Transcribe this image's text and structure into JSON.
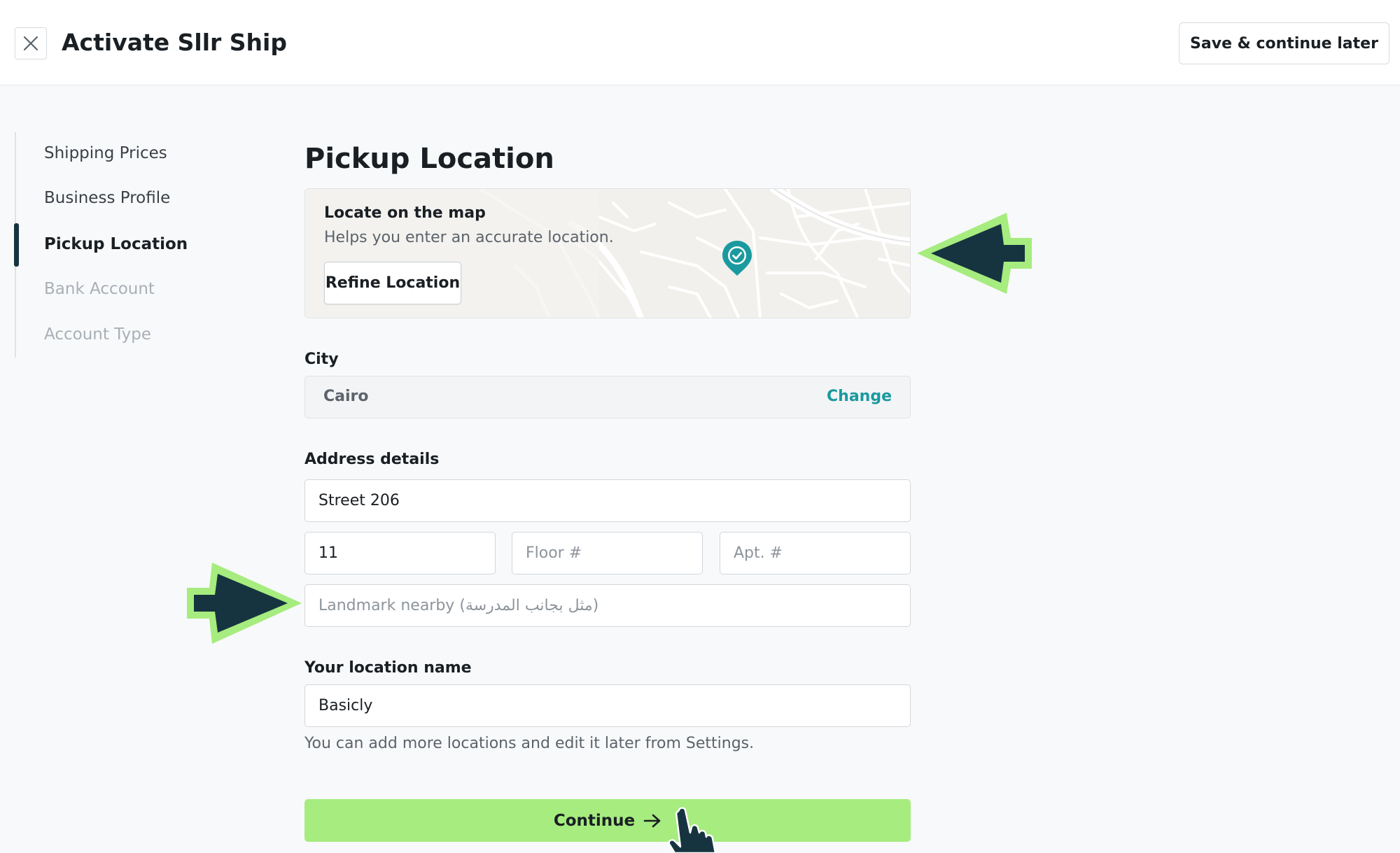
{
  "header": {
    "title": "Activate Sllr Ship",
    "save_later_label": "Save & continue later"
  },
  "stepper": {
    "steps": [
      {
        "label": "Shipping Prices",
        "state": "done"
      },
      {
        "label": "Business Profile",
        "state": "done"
      },
      {
        "label": "Pickup Location",
        "state": "active"
      },
      {
        "label": "Bank Account",
        "state": "todo"
      },
      {
        "label": "Account Type",
        "state": "todo"
      }
    ]
  },
  "main": {
    "title": "Pickup Location",
    "map_card": {
      "heading": "Locate on the map",
      "subtitle": "Helps you enter an accurate location.",
      "refine_label": "Refine Location"
    },
    "city": {
      "label": "City",
      "value": "Cairo",
      "change_label": "Change"
    },
    "address": {
      "label": "Address details",
      "street_value": "Street 206",
      "building_value": "11",
      "floor_placeholder": "Floor #",
      "apt_placeholder": "Apt. #",
      "landmark_placeholder": "Landmark nearby (مثل بجانب المدرسة)"
    },
    "location_name": {
      "label": "Your location name",
      "value": "Basicly",
      "help": "You can add more locations and edit it later from Settings."
    },
    "continue_label": "Continue"
  },
  "colors": {
    "accent": "#1a9a9f",
    "continue_bg": "#a6ec7f",
    "annotation_arrow_fill": "#16343f",
    "annotation_arrow_outline": "#a6ec7f"
  }
}
